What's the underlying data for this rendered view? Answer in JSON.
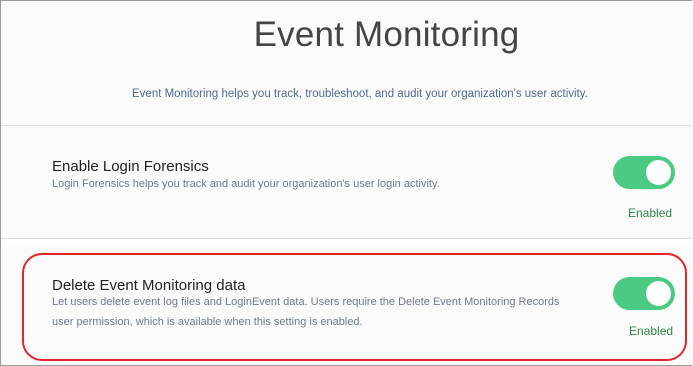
{
  "header": {
    "title": "Event Monitoring",
    "subtitle": "Event Monitoring helps you track, troubleshoot, and audit your organization's user activity."
  },
  "settings": [
    {
      "title": "Enable Login Forensics",
      "description": "Login Forensics helps you track and audit your organization's user login activity.",
      "enabled": true,
      "status": "Enabled"
    },
    {
      "title": "Delete Event Monitoring data",
      "description": "Let users delete event log files and LoginEvent data. Users require the Delete Event Monitoring Records user permission, which is available when this setting is enabled.",
      "enabled": true,
      "status": "Enabled"
    }
  ],
  "colors": {
    "toggle_on": "#4bca81",
    "status_text": "#2e844a",
    "highlight_border": "#e0262b"
  }
}
